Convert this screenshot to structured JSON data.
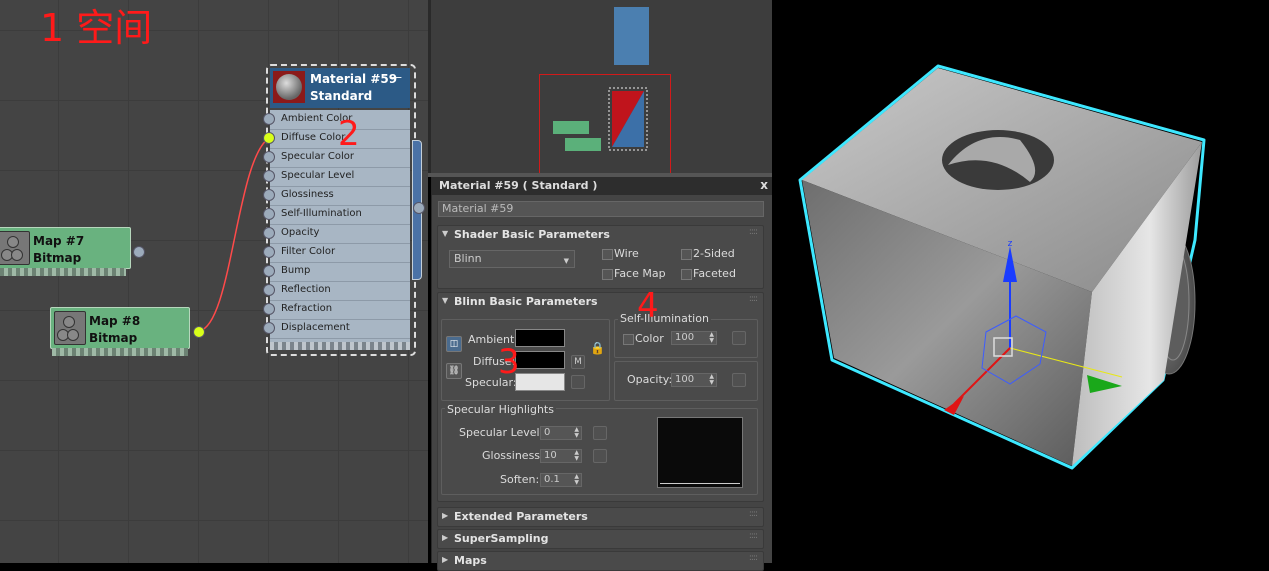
{
  "annotations": {
    "a1": "1 空间",
    "a2": "2",
    "a3": "3",
    "a4": "4"
  },
  "map7": {
    "title": "Map #7",
    "type": "Bitmap"
  },
  "map8": {
    "title": "Map #8",
    "type": "Bitmap"
  },
  "material_node": {
    "title": "Material #59",
    "type": "Standard",
    "collapse": "—",
    "slots": [
      "Ambient Color",
      "Diffuse Color",
      "Specular Color",
      "Specular Level",
      "Glossiness",
      "Self-Illumination",
      "Opacity",
      "Filter Color",
      "Bump",
      "Reflection",
      "Refraction",
      "Displacement"
    ]
  },
  "panel": {
    "title": "Material #59  ( Standard )",
    "close": "x",
    "name_field": "Material #59",
    "shader": {
      "title": "Shader Basic Parameters",
      "shader_value": "Blinn",
      "wire": "Wire",
      "two_sided": "2-Sided",
      "face_map": "Face Map",
      "faceted": "Faceted"
    },
    "blinn": {
      "title": "Blinn Basic Parameters",
      "ambient": "Ambient:",
      "diffuse": "Diffuse:",
      "specular": "Specular:",
      "m_button": "M",
      "self_illum": "Self-Illumination",
      "color": "Color",
      "color_value": "100",
      "opacity": "Opacity:",
      "opacity_value": "100",
      "spec_highlights": "Specular Highlights",
      "spec_level": "Specular Level:",
      "spec_level_value": "0",
      "glossiness": "Glossiness:",
      "glossiness_value": "10",
      "soften": "Soften:",
      "soften_value": "0.1"
    },
    "extended": "Extended Parameters",
    "supersampling": "SuperSampling",
    "maps": "Maps",
    "grip": "::::"
  },
  "gizmo": {
    "z": "z"
  },
  "colors": {
    "node_green": "#69b27f",
    "material_header": "#2c5a86",
    "wire_red": "#ff4a4a",
    "port_active": "#d9ff1a",
    "selection_cyan": "#3ee8ff"
  }
}
